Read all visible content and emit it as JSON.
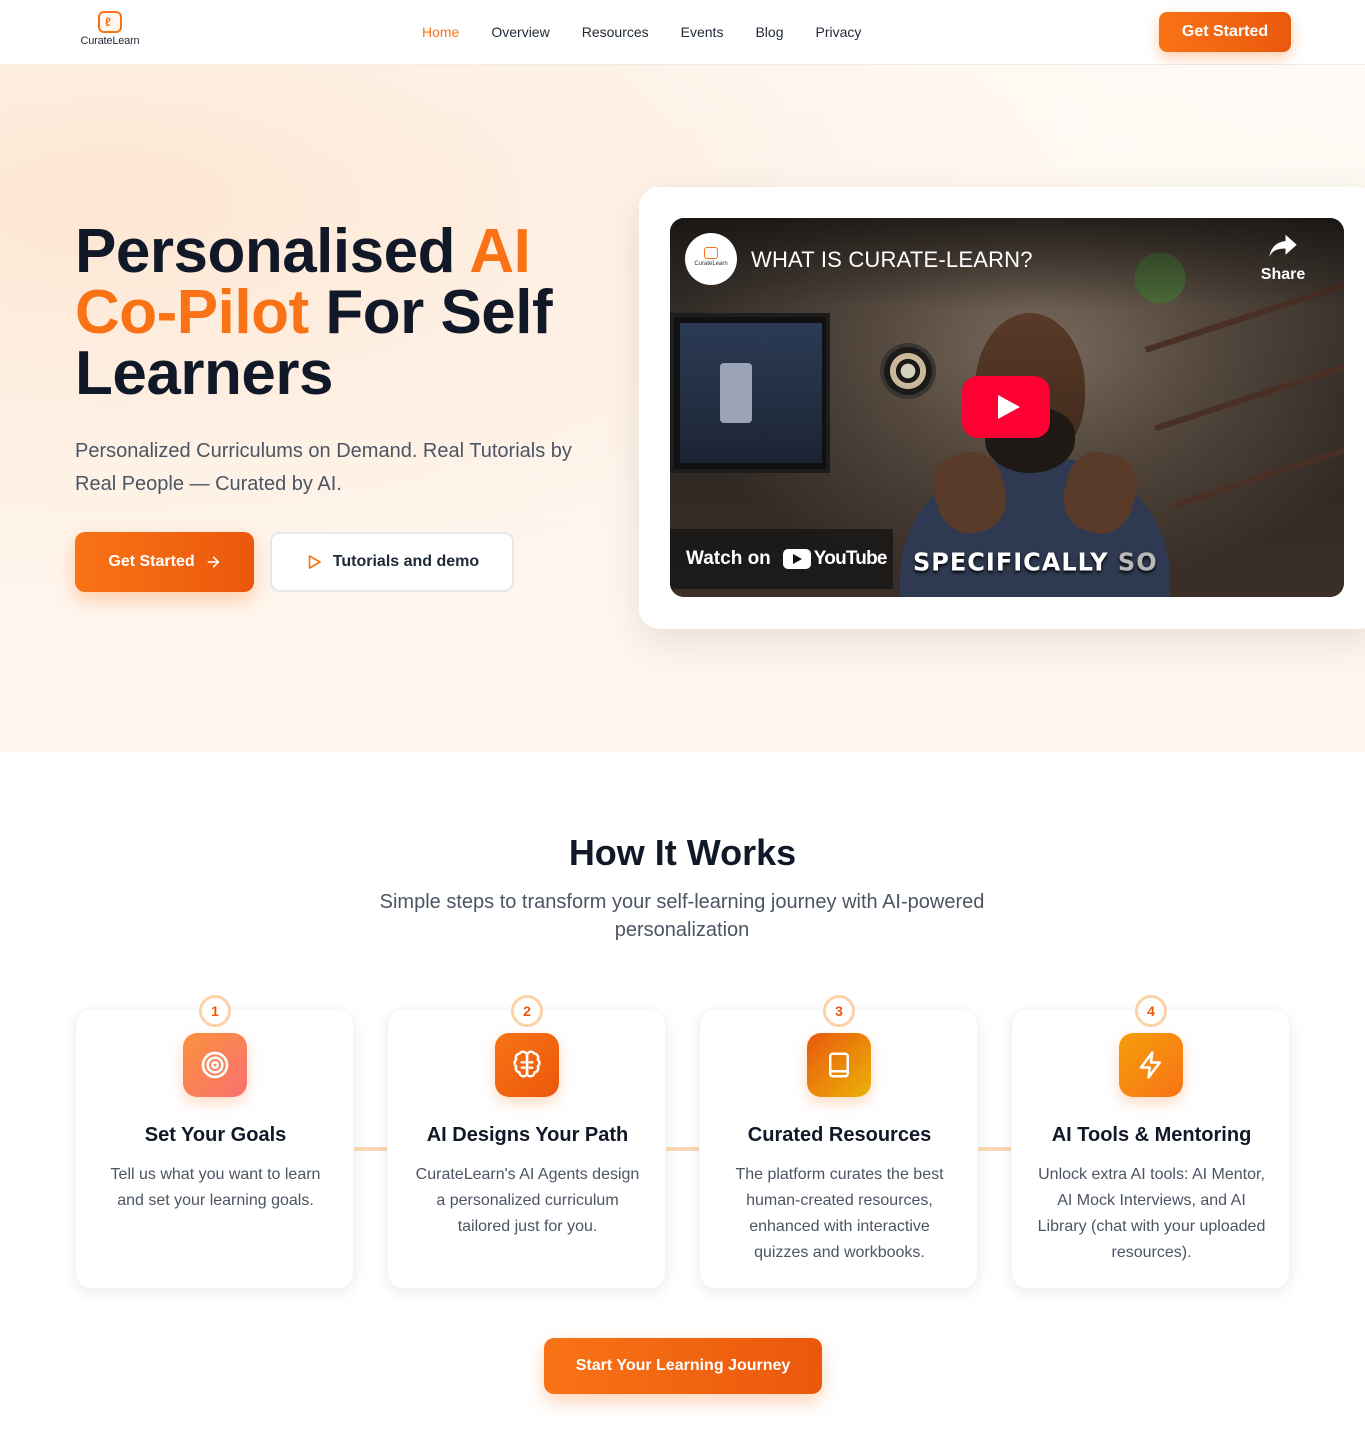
{
  "brand": {
    "name": "CurateLearn",
    "accent": "#f97316",
    "accent_dark": "#ea580c"
  },
  "nav": {
    "links": [
      {
        "label": "Home",
        "active": true
      },
      {
        "label": "Overview",
        "active": false
      },
      {
        "label": "Resources",
        "active": false
      },
      {
        "label": "Events",
        "active": false
      },
      {
        "label": "Blog",
        "active": false
      },
      {
        "label": "Privacy",
        "active": false
      }
    ],
    "cta_label": "Get Started"
  },
  "hero": {
    "title_part1": "Personalised ",
    "title_accent1": "AI",
    "title_accent2": "Co-Pilot",
    "title_part2": " For Self Learners",
    "subtitle": "Personalized Curriculums on Demand. Real Tutorials by Real People — Curated by AI.",
    "primary_button": "Get Started",
    "secondary_button": "Tutorials and demo"
  },
  "video": {
    "title": "WHAT IS CURATE-LEARN?",
    "channel": "CurateLearn",
    "share_label": "Share",
    "watch_on": "Watch on",
    "youtube": "YouTube",
    "caption_main": "SPECIFICALLY",
    "caption_dim": "SO",
    "play_color": "#ff0033"
  },
  "how": {
    "title": "How It Works",
    "subtitle": "Simple steps to transform your self-learning journey with AI-powered personalization",
    "steps": [
      {
        "num": "1",
        "icon": "target-icon",
        "title": "Set Your Goals",
        "desc": "Tell us what you want to learn and set your learning goals."
      },
      {
        "num": "2",
        "icon": "brain-icon",
        "title": "AI Designs Your Path",
        "desc": "CurateLearn's AI Agents design a personalized curriculum tailored just for you."
      },
      {
        "num": "3",
        "icon": "book-icon",
        "title": "Curated Resources",
        "desc": "The platform curates the best human-created resources, enhanced with interactive quizzes and workbooks."
      },
      {
        "num": "4",
        "icon": "lightning-icon",
        "title": "AI Tools & Mentoring",
        "desc": "Unlock extra AI tools: AI Mentor, AI Mock Interviews, and AI Library (chat with your uploaded resources)."
      }
    ],
    "cta_label": "Start Your Learning Journey"
  }
}
